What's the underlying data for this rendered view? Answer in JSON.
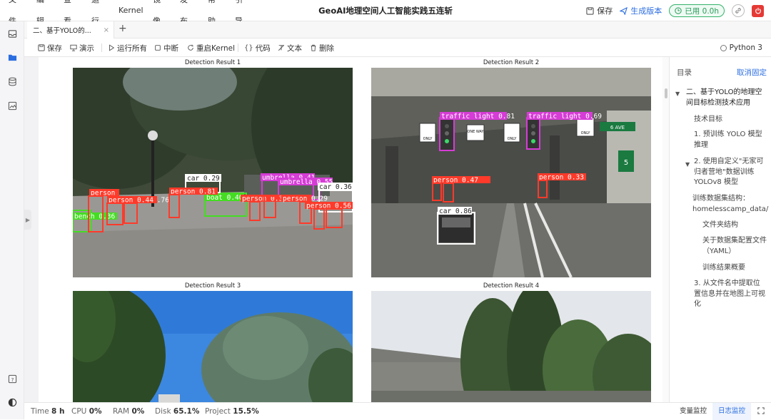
{
  "menu": [
    "文件",
    "编辑",
    "查看",
    "运行",
    "Kernel",
    "镜像",
    "发布",
    "帮助",
    "引导"
  ],
  "app_title": "GeoAI地理空间人工智能实践五连斩",
  "top_right": {
    "save_label": "保存",
    "publish_label": "生成版本",
    "usage_label": "已用 0.0h"
  },
  "tab": {
    "label": "二、基于YOLO的...",
    "close": "×",
    "add": "+"
  },
  "toolbar": {
    "save": "保存",
    "present": "演示",
    "run_all": "运行所有",
    "interrupt": "中断",
    "restart": "重启Kernel",
    "code": "代码",
    "text": "文本",
    "delete": "删除",
    "kernel": "Python 3"
  },
  "detections": [
    {
      "title": "Detection Result 1",
      "boxes": [
        {
          "label": "car 0.29",
          "color": "#ffffff"
        },
        {
          "label": "umbrella 0.41",
          "color": "#d63cd6"
        },
        {
          "label": "umbrella 0.55",
          "color": "#d63cd6"
        },
        {
          "label": "car 0.36",
          "color": "#ffffff"
        },
        {
          "label": "person 0.76",
          "color": "#ff3a2a"
        },
        {
          "label": "person 0.81",
          "color": "#ff3a2a"
        },
        {
          "label": "person",
          "color": "#ff3a2a"
        },
        {
          "label": "person 0.44",
          "color": "#ff3a2a"
        },
        {
          "label": "boat 0.40",
          "color": "#44dd22"
        },
        {
          "label": "person 0.35",
          "color": "#ff3a2a"
        },
        {
          "label": "person 0.29",
          "color": "#ff3a2a"
        },
        {
          "label": "person 0.56",
          "color": "#ff3a2a"
        },
        {
          "label": "bench 0.36",
          "color": "#44dd22"
        }
      ]
    },
    {
      "title": "Detection Result 2",
      "boxes": [
        {
          "label": "traffic light 0.81",
          "color": "#d63cd6"
        },
        {
          "label": "traffic light 0.69",
          "color": "#d63cd6"
        },
        {
          "label": "person 0.47",
          "color": "#ff3a2a"
        },
        {
          "label": "person 0.33",
          "color": "#ff3a2a"
        },
        {
          "label": "car 0.86",
          "color": "#ffffff"
        }
      ],
      "signs": [
        "ONLY",
        "ONE WAY",
        "ONLY",
        "ONLY",
        "6 AVE",
        "5"
      ]
    },
    {
      "title": "Detection Result 3"
    },
    {
      "title": "Detection Result 4"
    }
  ],
  "toc": {
    "title": "目录",
    "unpin": "取消固定",
    "items": [
      "二、基于YOLO的地理空间目标检测技术应用",
      "技术目标",
      "1. 预训练 YOLO 模型推理",
      "2. 使用自定义\"无家可归者营地\"数据训练 YOLOv8 模型",
      "训练数据集结构：homelesscamp_data/",
      "文件夹结构",
      "关于数据集配置文件（YAML）",
      "训练结果概要",
      "3. 从文件名中提取位置信息并在地图上可视化"
    ]
  },
  "status": {
    "time_label": "Time",
    "time_value": "8 h",
    "cpu_label": "CPU",
    "cpu_value": "0%",
    "ram_label": "RAM",
    "ram_value": "0%",
    "disk_label": "Disk",
    "disk_value": "65.1%",
    "project_label": "Project",
    "project_value": "15.5%",
    "var_monitor": "变量监控",
    "log_monitor": "日志监控"
  },
  "colors": {
    "accent": "#2b6de0",
    "usage_green": "#34b36a",
    "power_red": "#e53935",
    "person_box": "#ff3a2a",
    "umbrella_box": "#d63cd6",
    "boat_box": "#44dd22"
  }
}
